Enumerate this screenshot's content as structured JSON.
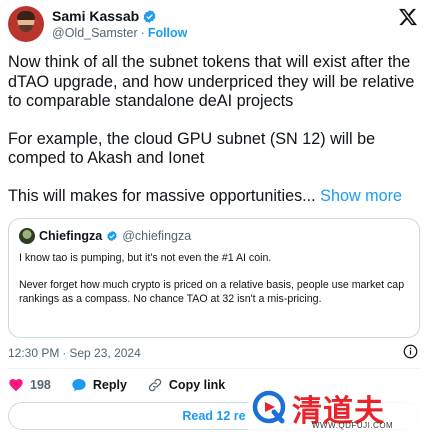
{
  "author": {
    "name": "Sami Kassab",
    "handle": "@Old_Samster",
    "separator": "·",
    "follow_label": "Follow"
  },
  "tweet": {
    "paragraphs": [
      "Now think of all the subnet tokens that will exist after the dTAO upgrade, and how underpriced they will be relative to comparable standalone deAI projects",
      "For example, the cloud GPU subnet (SN 12) will be comped to Akash and Ionet"
    ],
    "last_line": "This will makes for massive opportunities...",
    "show_more": "Show more"
  },
  "quote": {
    "name": "Chiefingza",
    "handle": "@chiefingza",
    "paragraphs": [
      "I know tao is pumping, but it's not even the #1 AI coin.",
      "Never forget how much crypto is priced on a relative basis, people use market cap rankings as a compass. No chance TAO at 32 isn't a mis-pricing."
    ]
  },
  "meta": {
    "time": "12:30 PM",
    "separator": "·",
    "date": "Sep 23, 2024"
  },
  "actions": {
    "like_count": "198",
    "reply_label": "Reply",
    "copy_label": "Copy link"
  },
  "read_replies": "Read 12 re",
  "watermark": {
    "cn_text": "清道夫",
    "url": "WWW.QDFUJI.COM"
  },
  "colors": {
    "accent": "#1d9bf0",
    "like": "#f91880",
    "text": "#0f1419",
    "muted": "#536471",
    "border": "#cfd9de",
    "watermark": "#e8232a"
  },
  "icons": [
    "verified-badge-icon",
    "x-logo-icon",
    "info-icon",
    "heart-icon",
    "reply-bubble-icon",
    "link-icon"
  ]
}
